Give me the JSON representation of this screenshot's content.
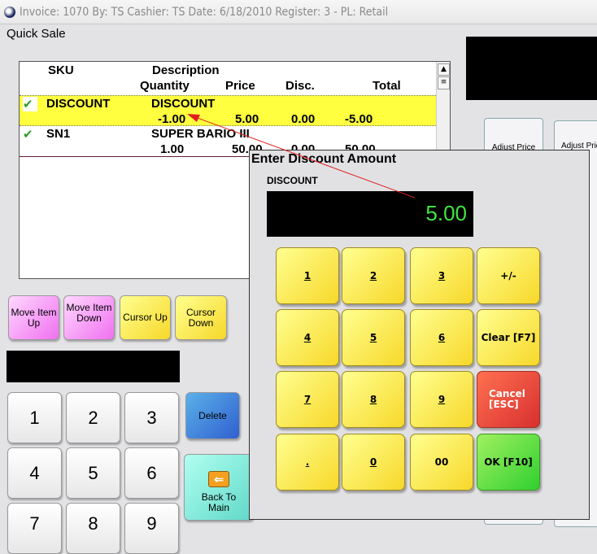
{
  "titlebar": {
    "text": "Invoice: 1070  By: TS   Cashier: TS   Date:  6/18/2010  Register: 3 - PL: Retail"
  },
  "screen_title": "Quick Sale",
  "list": {
    "headers": {
      "sku": "SKU",
      "description": "Description",
      "quantity": "Quantity",
      "price": "Price",
      "disc": "Disc.",
      "total": "Total"
    },
    "rows": [
      {
        "sku": "DISCOUNT",
        "description": "DISCOUNT",
        "quantity": "-1.00",
        "price": "5.00",
        "disc": "0.00",
        "total": "-5.00",
        "selected": true
      },
      {
        "sku": "SN1",
        "description": "SUPER BARIO III",
        "quantity": "1.00",
        "price": "50.00",
        "disc": "0.00",
        "total": "50.00",
        "selected": false
      }
    ]
  },
  "left_buttons": [
    "Move Item Up",
    "Move Item Down",
    "Cursor Up",
    "Cursor Down"
  ],
  "keypad": [
    "1",
    "2",
    "3",
    "4",
    "5",
    "6",
    "7",
    "8",
    "9"
  ],
  "delete_label": "Delete",
  "back_label": "Back To Main",
  "right_buttons": [
    "Adjust Price",
    "Adjust Price a"
  ],
  "dialog": {
    "title": "Enter Discount Amount",
    "field_label": "DISCOUNT",
    "value": "5.00",
    "keys": [
      "1",
      "2",
      "3",
      "+/-",
      "4",
      "5",
      "6",
      "Clear [F7]",
      "7",
      "8",
      "9",
      "Cancel [ESC]",
      ".",
      "0",
      "00",
      "OK [F10]"
    ]
  },
  "colors": {
    "selected_row": "#ffff40",
    "display_text": "#3ee63e",
    "cancel": "#e04838",
    "ok": "#50dd40",
    "annotation_arrow": "#e02020"
  }
}
